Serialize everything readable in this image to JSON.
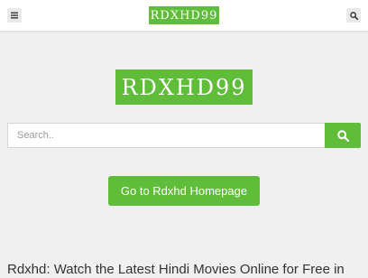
{
  "header": {
    "logo_text": "RDXHD99",
    "menu_icon": "bars-icon",
    "search_icon": "search-icon"
  },
  "hero": {
    "logo_text": "RDXHD99"
  },
  "search": {
    "placeholder": "Search..",
    "value": "",
    "submit_icon": "search-icon"
  },
  "home_button": {
    "label": "Go to Rdxhd Homepage"
  },
  "headline": {
    "text": "Rdxhd: Watch the Latest Hindi Movies Online for Free in"
  },
  "colors": {
    "accent": "#5fbd3a",
    "background": "#f0f0f0",
    "topbar": "#ffffff",
    "text": "#333333"
  }
}
